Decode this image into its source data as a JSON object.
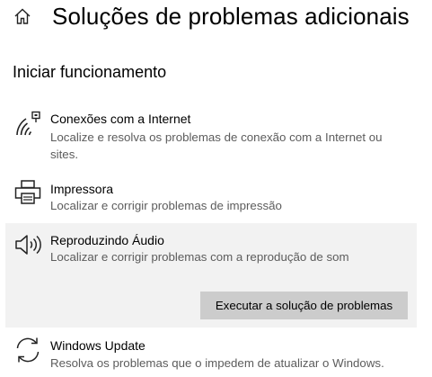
{
  "header": {
    "home_icon": "home-icon",
    "title": "Soluções de problemas adicionais"
  },
  "section": {
    "title": "Iniciar funcionamento"
  },
  "items": [
    {
      "icon": "wifi-broadcast-icon",
      "title": "Conexões com a Internet",
      "description": "Localize e resolva os problemas de conexão com a Internet ou sites."
    },
    {
      "icon": "printer-icon",
      "title": "Impressora",
      "description": "Localizar e corrigir problemas de impressão"
    },
    {
      "icon": "speaker-icon",
      "title": "Reproduzindo Áudio",
      "description": "Localizar e corrigir problemas com a reprodução de som",
      "selected": true,
      "button_label": "Executar a solução de problemas"
    },
    {
      "icon": "refresh-icon",
      "title": "Windows Update",
      "description": "Resolva os problemas que o impedem de atualizar o Windows."
    }
  ],
  "colors": {
    "selected_background": "#f2f2f2",
    "button_background": "#cccccc",
    "description_text": "#5c5c5c"
  }
}
